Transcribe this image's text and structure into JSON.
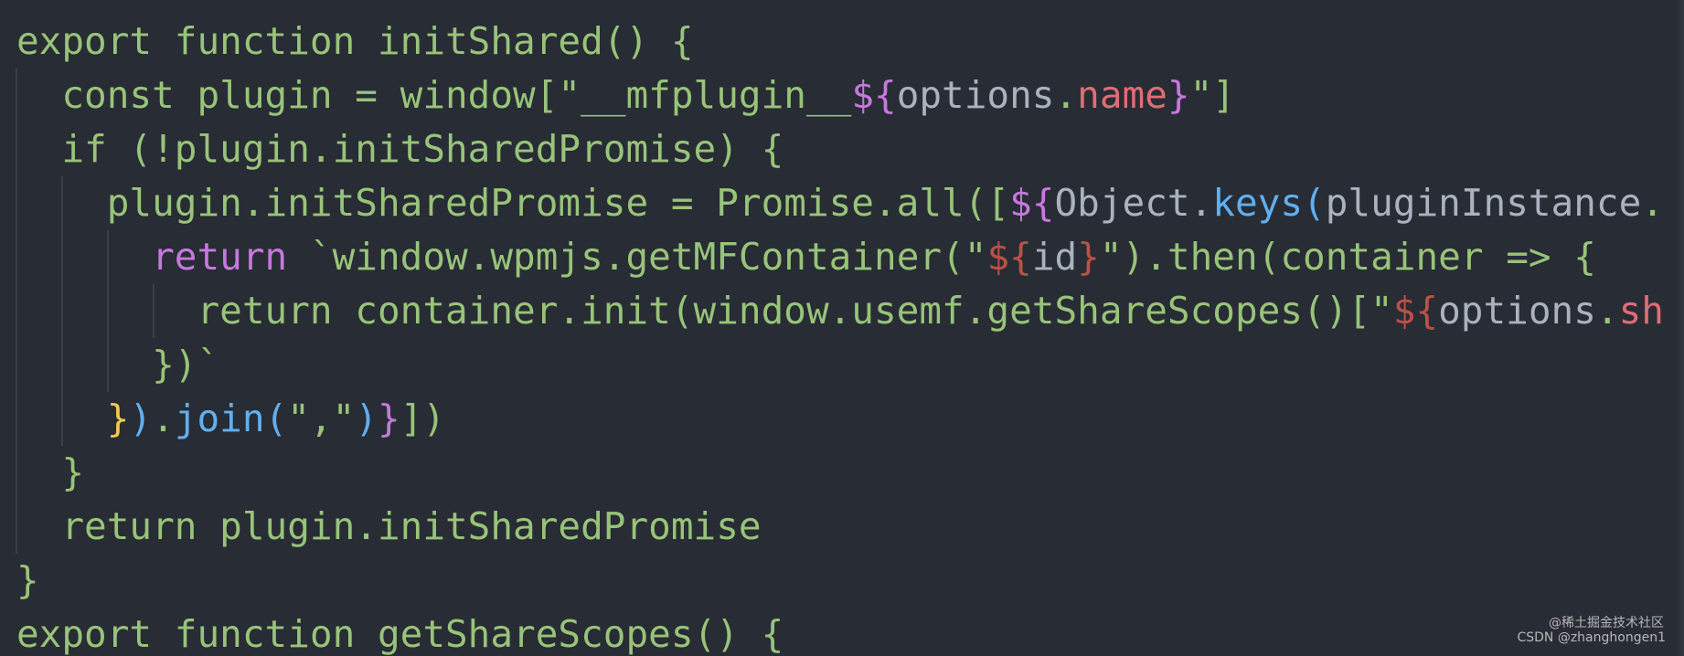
{
  "colors": {
    "background": "#282c34",
    "g": "#98c379",
    "p": "#c678dd",
    "r": "#e06c75",
    "o": "#be5046",
    "w": "#abb2bf",
    "b": "#61afef",
    "y": "#f0c94c"
  },
  "code_lines": [
    [
      [
        "export function initShared() {",
        "g"
      ]
    ],
    [
      [
        "  const plugin = window[\"__mfplugin__",
        "g"
      ],
      [
        "${",
        "p"
      ],
      [
        "options",
        "w"
      ],
      [
        ".",
        "g"
      ],
      [
        "name",
        "r"
      ],
      [
        "}",
        "p"
      ],
      [
        "\"]",
        "g"
      ]
    ],
    [
      [
        "  if (!plugin.initSharedPromise) {",
        "g"
      ]
    ],
    [
      [
        "    plugin.initSharedPromise = Promise.all([",
        "g"
      ],
      [
        "${",
        "p"
      ],
      [
        "Object.",
        "w"
      ],
      [
        "keys",
        "b"
      ],
      [
        "(",
        "b"
      ],
      [
        "pluginInstance",
        "w"
      ],
      [
        ".",
        "g"
      ]
    ],
    [
      [
        "      ",
        "g"
      ],
      [
        "return",
        "p"
      ],
      [
        " `window.wpmjs.getMFContainer(\"",
        "g"
      ],
      [
        "${",
        "o"
      ],
      [
        "id",
        "w"
      ],
      [
        "}",
        "o"
      ],
      [
        "\").then(container => {",
        "g"
      ]
    ],
    [
      [
        "        return container.init(window.usemf.getShareScopes()[\"",
        "g"
      ],
      [
        "${",
        "o"
      ],
      [
        "options",
        "w"
      ],
      [
        ".",
        "g"
      ],
      [
        "sh",
        "r"
      ]
    ],
    [
      [
        "      })`",
        "g"
      ]
    ],
    [
      [
        "    ",
        "g"
      ],
      [
        "}",
        "y"
      ],
      [
        ")",
        "b"
      ],
      [
        ".",
        "g"
      ],
      [
        "join",
        "b"
      ],
      [
        "(",
        "b"
      ],
      [
        "\",\"",
        "g"
      ],
      [
        ")",
        "b"
      ],
      [
        "}",
        "p"
      ],
      [
        "])",
        "g"
      ]
    ],
    [
      [
        "  }",
        "g"
      ]
    ],
    [
      [
        "  return plugin.initSharedPromise",
        "g"
      ]
    ],
    [
      [
        "}",
        "g"
      ]
    ],
    [
      [
        "export function getShareScopes() {",
        "g"
      ]
    ]
  ],
  "watermark": {
    "line1": "@稀土掘金技术社区",
    "line2": "CSDN @zhanghongen1"
  }
}
